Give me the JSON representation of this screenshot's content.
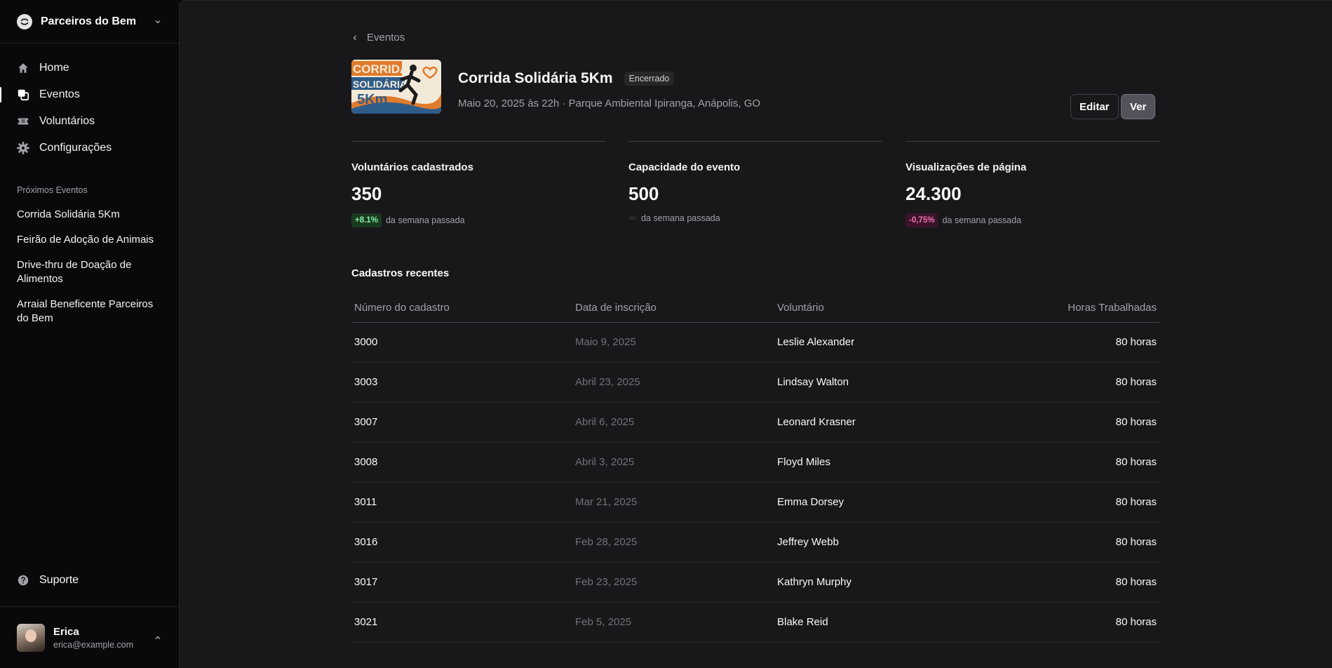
{
  "team": {
    "name": "Parceiros do Bem"
  },
  "nav": {
    "home": "Home",
    "eventos": "Eventos",
    "voluntarios": "Voluntários",
    "configuracoes": "Configurações"
  },
  "upcoming": {
    "title": "Próximos Eventos",
    "items": [
      "Corrida Solidária 5Km",
      "Feirão de Adoção de Animais",
      "Drive-thru de Doação de Alimentos",
      "Arraial Beneficente Parceiros do Bem"
    ]
  },
  "support": "Suporte",
  "user": {
    "name": "Erica",
    "email": "erica@example.com"
  },
  "breadcrumb": "Eventos",
  "event": {
    "image_text": {
      "line1": "CORRIDA",
      "line2": "SOLIDÁRIA",
      "line3": "5Km"
    },
    "title": "Corrida Solidária 5Km",
    "status": "Encerrado",
    "meta": "Maio 20, 2025 às 22h · Parque Ambiental Ipiranga, Anápolis, GO",
    "edit_label": "Editar",
    "view_label": "Ver"
  },
  "stats": [
    {
      "label": "Voluntários cadastrados",
      "value": "350",
      "change": "+8.1%",
      "trend": "positive",
      "suffix": "da semana passada"
    },
    {
      "label": "Capacidade do evento",
      "value": "500",
      "change": "",
      "trend": "neutral",
      "suffix": "da semana passada"
    },
    {
      "label": "Visualizações de página",
      "value": "24.300",
      "change": "-0,75%",
      "trend": "negative",
      "suffix": "da semana passada"
    }
  ],
  "recent": {
    "title": "Cadastros recentes",
    "columns": [
      "Número do cadastro",
      "Data de inscrição",
      "Voluntário",
      "Horas Trabalhadas"
    ],
    "rows": [
      {
        "id": "3000",
        "date": "Maio 9, 2025",
        "name": "Leslie Alexander",
        "hours": "80 horas"
      },
      {
        "id": "3003",
        "date": "Abril 23, 2025",
        "name": "Lindsay Walton",
        "hours": "80 horas"
      },
      {
        "id": "3007",
        "date": "Abril 6, 2025",
        "name": "Leonard Krasner",
        "hours": "80 horas"
      },
      {
        "id": "3008",
        "date": "Abril 3, 2025",
        "name": "Floyd Miles",
        "hours": "80 horas"
      },
      {
        "id": "3011",
        "date": "Mar 21, 2025",
        "name": "Emma Dorsey",
        "hours": "80 horas"
      },
      {
        "id": "3016",
        "date": "Feb 28, 2025",
        "name": "Jeffrey Webb",
        "hours": "80 horas"
      },
      {
        "id": "3017",
        "date": "Feb 23, 2025",
        "name": "Kathryn Murphy",
        "hours": "80 horas"
      },
      {
        "id": "3021",
        "date": "Feb 5, 2025",
        "name": "Blake Reid",
        "hours": "80 horas"
      }
    ]
  },
  "colors": {
    "accent_positive": "#86efac",
    "accent_negative": "#f472b6",
    "background": "#18181b",
    "sidebar": "#09090b"
  },
  "icons": [
    "logo-icon",
    "chevron-down-icon",
    "home-icon",
    "calendar-icon",
    "ticket-icon",
    "gear-icon",
    "help-icon",
    "chevron-up-icon",
    "chevron-left-icon"
  ]
}
